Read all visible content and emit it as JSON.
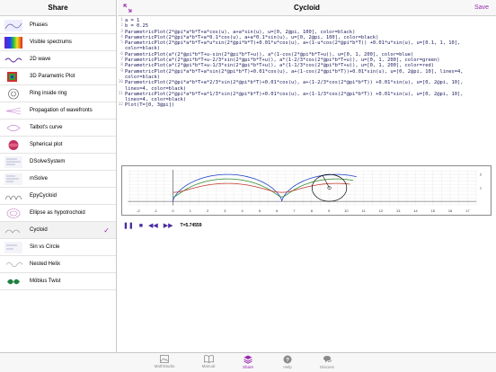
{
  "sidebar": {
    "title": "Share",
    "items": [
      {
        "label": "Phases"
      },
      {
        "label": "Visible spectrums"
      },
      {
        "label": "2D wave"
      },
      {
        "label": "3D Parametric Plot"
      },
      {
        "label": "Ring inside ring"
      },
      {
        "label": "Propagation of wavefronts"
      },
      {
        "label": "Talbot's curve"
      },
      {
        "label": "Spherical plot"
      },
      {
        "label": "DSolveSystem"
      },
      {
        "label": "mSolve"
      },
      {
        "label": "EpyCycloid"
      },
      {
        "label": "Ellipse as hypotrochoid"
      },
      {
        "label": "Cycloid",
        "selected": true
      },
      {
        "label": "Sin vs Circle"
      },
      {
        "label": "Nested Helix"
      },
      {
        "label": "Möbius Twist"
      }
    ],
    "check_glyph": "✓"
  },
  "main": {
    "title": "Cycloid",
    "save_label": "Save",
    "code_lines": [
      {
        "n": "1",
        "text": "a = 1"
      },
      {
        "n": "2",
        "text": "b = 0.25"
      },
      {
        "n": "3",
        "text": "ParametricPlot(2*@pi*a*b*T+a*cos(u), a+a*sin(u), u=[0, 2@pi, 100], color=black)"
      },
      {
        "n": "4",
        "text": "ParametricPlot(2*@pi*a*b*T+a*0.1*cos(u), a+a*0.1*sin(u), u=[0, 2@pi, 100], color=black)"
      },
      {
        "n": "5",
        "text": "ParametricPlot(2*@pi*a*b*T+a*u*sin(2*@pi*b*T)+0.01*u*cos(u), a+(1-u*cos(2*@pi*b*T)) +0.01*u*sin(u), u=[0.1, 1, 10], color=black)"
      },
      {
        "n": "6",
        "text": "ParametricPlot(a*(2*@pi*b*T+u-sin(2*@pi*b*T+u)), a*(1-cos(2*@pi*b*T+u)), u=[0, 1, 200], color=blue)"
      },
      {
        "n": "7",
        "text": "ParametricPlot(a*(2*@pi*b*T+u-2/3*sin(2*@pi*b*T+u)), a*(1-2/3*cos(2*@pi*b*T+u)), u=[0, 1, 200], color=green)"
      },
      {
        "n": "8",
        "text": "ParametricPlot(a*(2*@pi*b*T+u-1/3*sin(2*@pi*b*T+u)), a*(1-1/3*cos(2*@pi*b*T+u)), u=[0, 1, 200], color=red)"
      },
      {
        "n": "9",
        "text": "ParametricPlot(2*@pi*a*b*T+a*sin(2*@pi*b*T)+0.01*cos(u), a+(1-cos(2*@pi*b*T))+0.01*sin(u), u=[0, 2@pi, 10], lines=4, color=black)"
      },
      {
        "n": "10",
        "text": "ParametricPlot(2*@pi*a*b*T+a*2/3*sin(2*@pi*b*T)+0.01*cos(u), a+(1-2/3*cos(2*@pi*b*T)) +0.01*sin(u), u=[0, 2@pi, 10], lines=4, color=black)"
      },
      {
        "n": "11",
        "text": "ParametricPlot(2*@pi*a*b*T+a*1/3*sin(2*@pi*b*T)+0.01*cos(u), a+(1-1/3*cos(2*@pi*b*T)) +0.01*sin(u), u=[0, 2@pi, 10], lines=4, color=black)"
      },
      {
        "n": "12",
        "text": "Plot(T=[0, 3@pi])"
      }
    ],
    "graph": {
      "x_ticks": [
        "-2",
        "-1",
        "0",
        "1",
        "2",
        "3",
        "4",
        "5",
        "6",
        "7",
        "8",
        "9",
        "10",
        "11",
        "12",
        "13",
        "14",
        "15",
        "16",
        "17"
      ],
      "y_ticks": [
        "2",
        "1"
      ]
    },
    "controls": {
      "play_glyph": "❚❚",
      "stop_glyph": "■",
      "rewind_glyph": "◀◀",
      "forward_glyph": "▶▶",
      "t_value": "T=5.74559"
    }
  },
  "tabbar": {
    "tabs": [
      {
        "label": "MathStudio",
        "icon": "image-icon"
      },
      {
        "label": "Manual",
        "icon": "book-icon"
      },
      {
        "label": "Share",
        "icon": "share-icon",
        "active": true
      },
      {
        "label": "Help",
        "icon": "help-icon"
      },
      {
        "label": "Discuss",
        "icon": "discuss-icon"
      }
    ]
  },
  "colors": {
    "accent": "#9c27b0",
    "blue": "#1a3fc7",
    "green": "#2e8b2e",
    "red": "#c0392b"
  }
}
